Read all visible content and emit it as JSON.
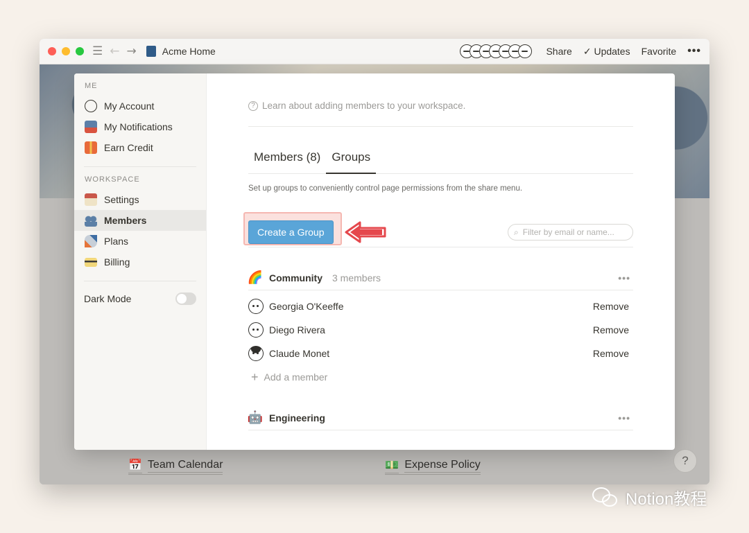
{
  "window": {
    "title": "Acme Home",
    "toolbar": {
      "share": "Share",
      "updates": "Updates",
      "favorite": "Favorite",
      "more": "•••"
    }
  },
  "page": {
    "links": [
      {
        "icon": "calendar-icon",
        "label": "Team Calendar"
      },
      {
        "icon": "money-icon",
        "label": "Expense Policy"
      }
    ],
    "help": "?"
  },
  "sidebar": {
    "me_header": "ME",
    "me_items": [
      {
        "label": "My Account",
        "icon": "avatar-icon"
      },
      {
        "label": "My Notifications",
        "icon": "mailbox-icon"
      },
      {
        "label": "Earn Credit",
        "icon": "gift-icon"
      }
    ],
    "workspace_header": "WORKSPACE",
    "workspace_items": [
      {
        "label": "Settings",
        "icon": "house-icon"
      },
      {
        "label": "Members",
        "icon": "people-icon",
        "active": true
      },
      {
        "label": "Plans",
        "icon": "rocket-icon"
      },
      {
        "label": "Billing",
        "icon": "credit-card-icon"
      }
    ],
    "dark_mode": {
      "label": "Dark Mode",
      "enabled": false
    }
  },
  "main": {
    "learn_text": "Learn about adding members to your workspace.",
    "tabs": [
      {
        "label": "Members (8)",
        "active": false
      },
      {
        "label": "Groups",
        "active": true
      }
    ],
    "description": "Set up groups to conveniently control page permissions from the share menu.",
    "create_button": "Create a Group",
    "filter_placeholder": "Filter by email or name...",
    "groups": [
      {
        "emoji": "🌈",
        "name": "Community",
        "count": "3 members",
        "members": [
          {
            "name": "Georgia O'Keeffe",
            "action": "Remove"
          },
          {
            "name": "Diego Rivera",
            "action": "Remove"
          },
          {
            "name": "Claude Monet",
            "action": "Remove"
          }
        ],
        "add_label": "Add a member"
      },
      {
        "emoji": "🤖",
        "name": "Engineering",
        "count": "",
        "members": []
      }
    ]
  },
  "watermark": "Notion教程",
  "colors": {
    "accent": "#5aa5d8",
    "highlight": "#f5b7b1",
    "arrow": "#e5484d"
  }
}
